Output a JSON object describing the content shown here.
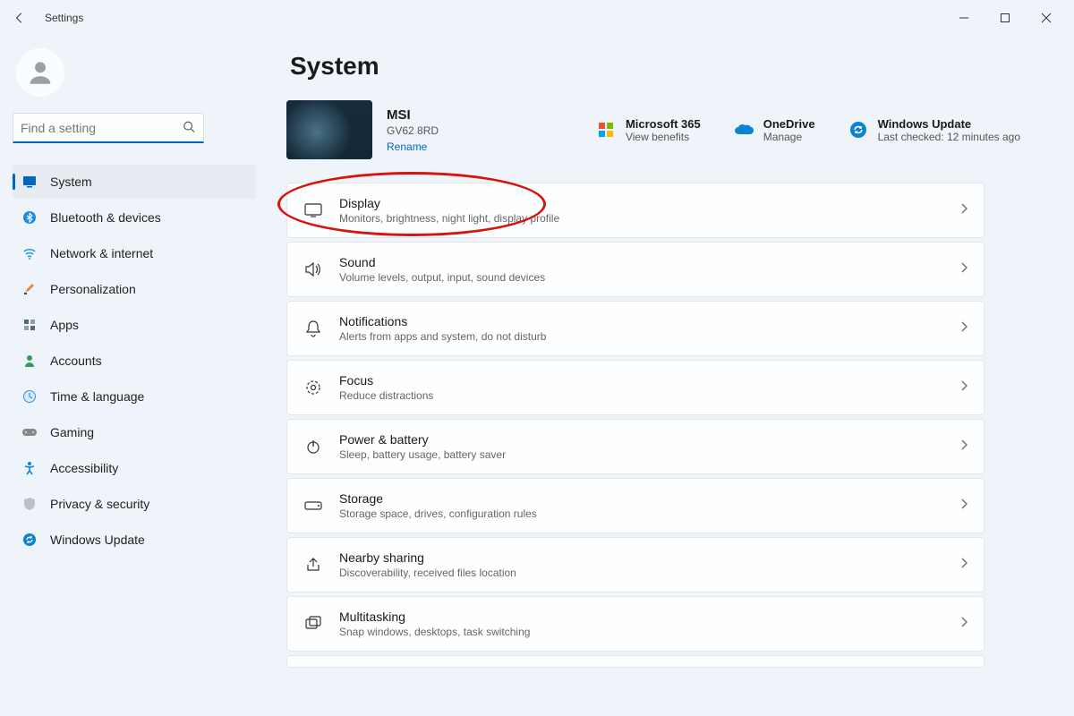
{
  "titlebar": {
    "title": "Settings"
  },
  "search": {
    "placeholder": "Find a setting"
  },
  "nav": {
    "items": [
      {
        "label": "System"
      },
      {
        "label": "Bluetooth & devices"
      },
      {
        "label": "Network & internet"
      },
      {
        "label": "Personalization"
      },
      {
        "label": "Apps"
      },
      {
        "label": "Accounts"
      },
      {
        "label": "Time & language"
      },
      {
        "label": "Gaming"
      },
      {
        "label": "Accessibility"
      },
      {
        "label": "Privacy & security"
      },
      {
        "label": "Windows Update"
      }
    ]
  },
  "page": {
    "title": "System"
  },
  "device": {
    "name": "MSI",
    "model": "GV62 8RD",
    "rename": "Rename"
  },
  "status": {
    "m365": {
      "title": "Microsoft 365",
      "sub": "View benefits"
    },
    "onedrive": {
      "title": "OneDrive",
      "sub": "Manage"
    },
    "update": {
      "title": "Windows Update",
      "sub": "Last checked: 12 minutes ago"
    }
  },
  "cards": [
    {
      "title": "Display",
      "sub": "Monitors, brightness, night light, display profile"
    },
    {
      "title": "Sound",
      "sub": "Volume levels, output, input, sound devices"
    },
    {
      "title": "Notifications",
      "sub": "Alerts from apps and system, do not disturb"
    },
    {
      "title": "Focus",
      "sub": "Reduce distractions"
    },
    {
      "title": "Power & battery",
      "sub": "Sleep, battery usage, battery saver"
    },
    {
      "title": "Storage",
      "sub": "Storage space, drives, configuration rules"
    },
    {
      "title": "Nearby sharing",
      "sub": "Discoverability, received files location"
    },
    {
      "title": "Multitasking",
      "sub": "Snap windows, desktops, task switching"
    }
  ]
}
